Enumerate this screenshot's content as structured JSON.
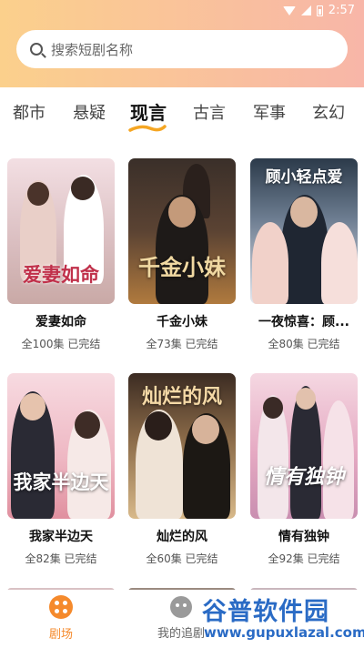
{
  "status_bar": {
    "time": "2:57"
  },
  "search": {
    "placeholder": "搜索短剧名称"
  },
  "tabs": [
    {
      "label": "都市",
      "active": false
    },
    {
      "label": "悬疑",
      "active": false
    },
    {
      "label": "现言",
      "active": true
    },
    {
      "label": "古言",
      "active": false
    },
    {
      "label": "军事",
      "active": false
    },
    {
      "label": "玄幻",
      "active": false
    }
  ],
  "dramas": [
    {
      "title": "爱妻如命",
      "poster_text": "爱妻如命",
      "episodes": "全100集",
      "status": "已完结",
      "poster_colors": [
        "#f3dfe3",
        "#c9a9a6"
      ]
    },
    {
      "title": "千金小妹",
      "poster_text": "千金小妹",
      "episodes": "全73集",
      "status": "已完结",
      "poster_colors": [
        "#4a3b33",
        "#b07a3e"
      ]
    },
    {
      "title": "一夜惊喜：顾...",
      "poster_text": "顾小轻点爱",
      "episodes": "全80集",
      "status": "已完结",
      "poster_colors": [
        "#2c3a4a",
        "#e6e8ef"
      ]
    },
    {
      "title": "我家半边天",
      "poster_text": "我家半边天",
      "episodes": "全82集",
      "status": "已完结",
      "poster_colors": [
        "#f4cbd3",
        "#e0909f"
      ]
    },
    {
      "title": "灿烂的风",
      "poster_text": "灿烂的风",
      "episodes": "全60集",
      "status": "已完结",
      "poster_colors": [
        "#d8b98a",
        "#7a5a3a"
      ]
    },
    {
      "title": "情有独钟",
      "poster_text": "情有独钟",
      "episodes": "全92集",
      "status": "已完结",
      "poster_colors": [
        "#f0c4d2",
        "#c98fb0"
      ]
    }
  ],
  "bottom_nav": [
    {
      "label": "剧场",
      "active": true,
      "icon": "theater-icon"
    },
    {
      "label": "我的追剧",
      "active": false,
      "icon": "face-icon"
    }
  ],
  "watermark": {
    "name": "谷普软件园",
    "url": "www.gupuxlazal.com"
  },
  "colors": {
    "accent": "#f58a2c",
    "header_start": "#fbd08c",
    "header_end": "#f8b6a8"
  }
}
